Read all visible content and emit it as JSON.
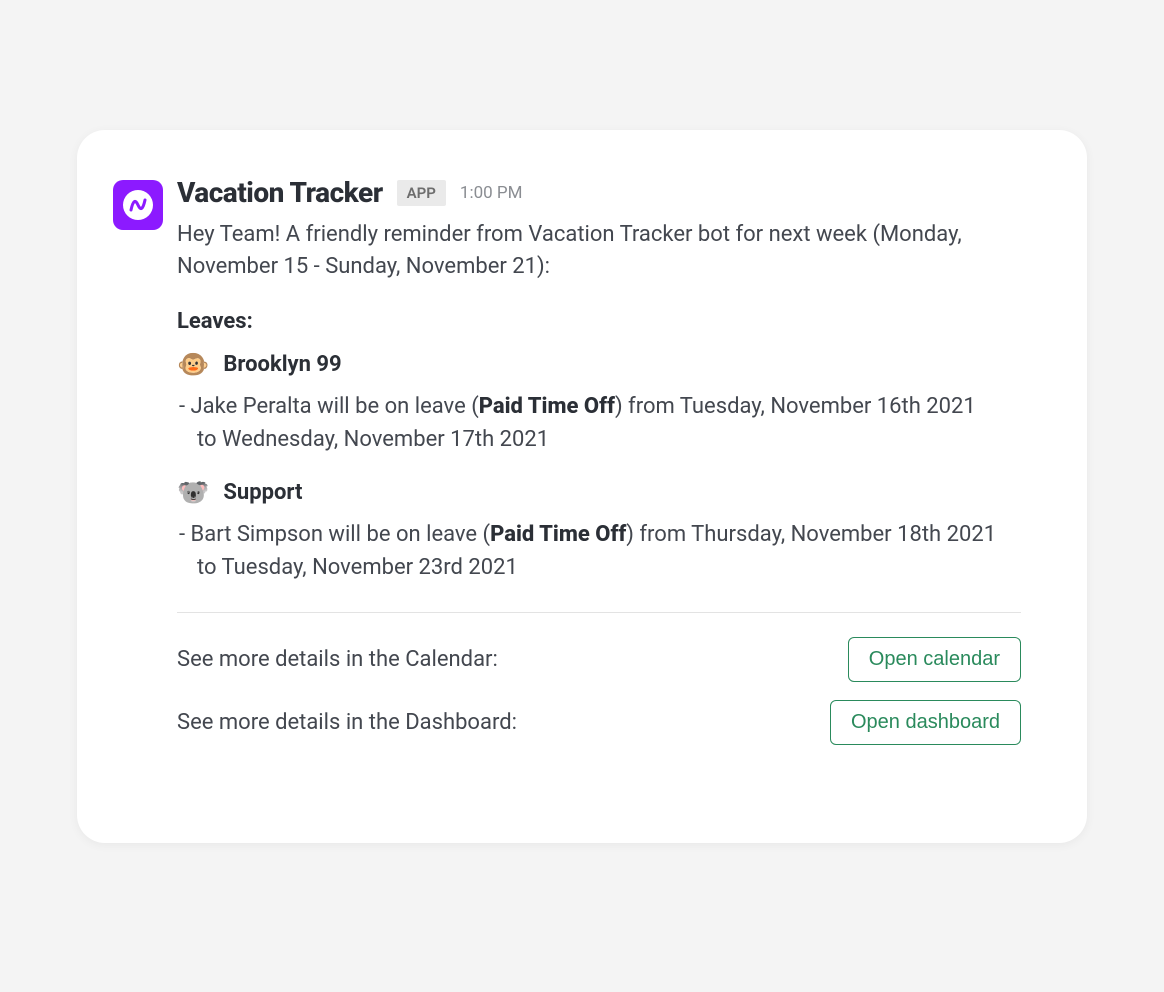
{
  "header": {
    "app_name": "Vacation Tracker",
    "badge": "APP",
    "time": "1:00 PM"
  },
  "message": "Hey Team! A friendly reminder from Vacation Tracker bot for next week (Monday, November 15 - Sunday, November 21):",
  "leaves_title": "Leaves:",
  "groups": [
    {
      "emoji": "🐵",
      "name": "Brooklyn 99",
      "item_pre": "- Jake Peralta will be on leave (",
      "item_type": "Paid Time Off",
      "item_mid": ") from Tuesday, November 16th 2021",
      "item_tail": "to Wednesday, November 17th 2021"
    },
    {
      "emoji": "🐨",
      "name": "Support",
      "item_pre": "- Bart Simpson will be on leave (",
      "item_type": "Paid Time Off",
      "item_mid": ") from Thursday, November 18th 2021",
      "item_tail": "to Tuesday, November 23rd 2021"
    }
  ],
  "actions": {
    "calendar_label": "See more details in the Calendar:",
    "calendar_btn": "Open calendar",
    "dashboard_label": "See more details in the Dashboard:",
    "dashboard_btn": "Open dashboard"
  }
}
